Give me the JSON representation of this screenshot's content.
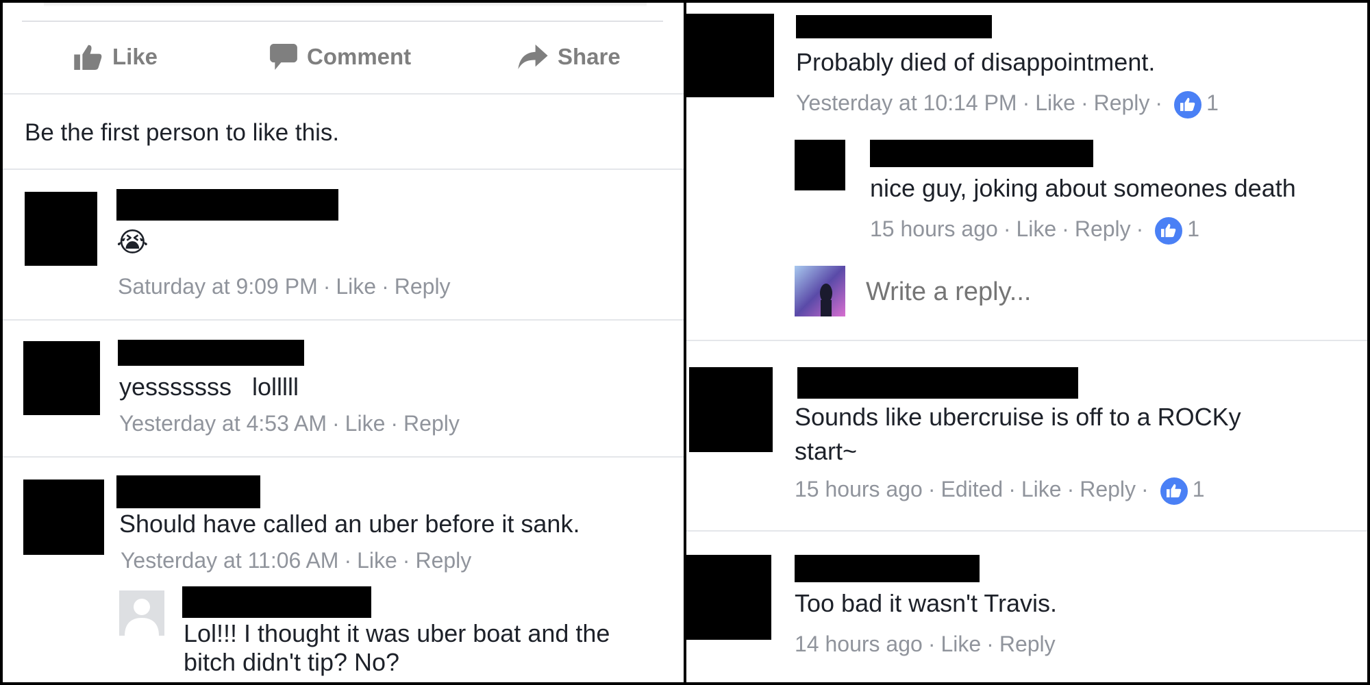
{
  "left": {
    "actions": {
      "like": "Like",
      "comment": "Comment",
      "share": "Share"
    },
    "likes_prompt": "Be the first person to like this.",
    "comments": [
      {
        "text": "😭",
        "time": "Saturday at 9:09 PM",
        "like": "Like",
        "reply": "Reply"
      },
      {
        "text": "yesssssss   lolllll",
        "time": "Yesterday at 4:53 AM",
        "like": "Like",
        "reply": "Reply"
      },
      {
        "text": "Should have called an uber before it sank.",
        "time": "Yesterday at 11:06 AM",
        "like": "Like",
        "reply": "Reply"
      }
    ],
    "reply": {
      "line1": "Lol!!! I thought it was uber boat and the",
      "line2": "bitch didn't tip? No?"
    }
  },
  "right": {
    "comments": [
      {
        "text": "Probably died of disappointment.",
        "time": "Yesterday at 10:14 PM",
        "like": "Like",
        "reply": "Reply",
        "reactions": "1"
      },
      {
        "line1": "Sounds like ubercruise is off to a ROCKy",
        "line2": "start~",
        "time": "15 hours ago",
        "edited": "Edited",
        "like": "Like",
        "reply": "Reply",
        "reactions": "1"
      },
      {
        "text": "Too bad it wasn't Travis.",
        "time": "14 hours ago",
        "like": "Like",
        "reply": "Reply"
      }
    ],
    "reply": {
      "text": "nice guy, joking about someones death",
      "time": "15 hours ago",
      "like": "Like",
      "reply": "Reply",
      "reactions": "1"
    },
    "reply_input": {
      "placeholder": "Write a reply..."
    }
  },
  "colors": {
    "accent": "#4a80f5",
    "meta": "#90949c",
    "text": "#1d2129"
  }
}
